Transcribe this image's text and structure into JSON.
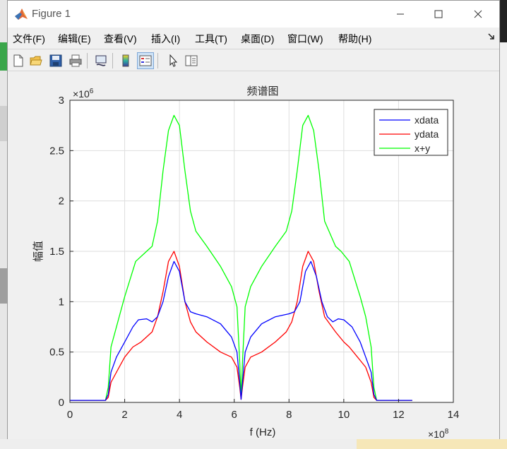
{
  "window": {
    "title": "Figure 1"
  },
  "menu": {
    "items": [
      {
        "label": "文件(F)",
        "name": "menu-file"
      },
      {
        "label": "编辑(E)",
        "name": "menu-edit"
      },
      {
        "label": "查看(V)",
        "name": "menu-view"
      },
      {
        "label": "插入(I)",
        "name": "menu-insert"
      },
      {
        "label": "工具(T)",
        "name": "menu-tools"
      },
      {
        "label": "桌面(D)",
        "name": "menu-desktop"
      },
      {
        "label": "窗口(W)",
        "name": "menu-window"
      },
      {
        "label": "帮助(H)",
        "name": "menu-help"
      }
    ]
  },
  "toolbar": {
    "items": [
      "new-figure-icon",
      "open-file-icon",
      "save-icon",
      "print-icon",
      "link-plot-icon",
      "colorbar-icon",
      "legend-icon",
      "pointer-icon",
      "property-inspector-icon"
    ]
  },
  "chart_data": {
    "type": "line",
    "title": "频谱图",
    "xlabel": "f (Hz)",
    "ylabel": "幅值",
    "x_exponent": "×10^8",
    "y_exponent": "×10^6",
    "xlim": [
      0,
      14
    ],
    "ylim": [
      0,
      3
    ],
    "xticks": [
      0,
      2,
      4,
      6,
      8,
      10,
      12,
      14
    ],
    "yticks": [
      0,
      0.5,
      1,
      1.5,
      2,
      2.5,
      3
    ],
    "xtick_labels": [
      "0",
      "2",
      "4",
      "6",
      "8",
      "10",
      "12",
      "14"
    ],
    "ytick_labels": [
      "0",
      "0.5",
      "1",
      "1.5",
      "2",
      "2.5",
      "3"
    ],
    "grid": true,
    "legend_position": "top-right",
    "series": [
      {
        "name": "xdata",
        "color": "#0000ff",
        "x": [
          0,
          1.3,
          1.4,
          1.5,
          1.7,
          2.0,
          2.3,
          2.5,
          2.8,
          3.0,
          3.2,
          3.4,
          3.6,
          3.8,
          4.0,
          4.2,
          4.4,
          4.6,
          5.0,
          5.5,
          5.9,
          6.1,
          6.2,
          6.25,
          6.3,
          6.4,
          6.6,
          7.0,
          7.5,
          8.0,
          8.2,
          8.4,
          8.6,
          8.8,
          9.0,
          9.2,
          9.4,
          9.6,
          9.8,
          10.0,
          10.3,
          10.6,
          10.8,
          11.0,
          11.1,
          11.2,
          12.5
        ],
        "y": [
          0.02,
          0.02,
          0.08,
          0.3,
          0.45,
          0.6,
          0.75,
          0.82,
          0.83,
          0.8,
          0.85,
          1.0,
          1.25,
          1.4,
          1.3,
          1.0,
          0.9,
          0.88,
          0.85,
          0.78,
          0.65,
          0.5,
          0.2,
          0.03,
          0.2,
          0.5,
          0.65,
          0.78,
          0.85,
          0.88,
          0.9,
          1.0,
          1.3,
          1.4,
          1.25,
          1.0,
          0.85,
          0.8,
          0.83,
          0.82,
          0.75,
          0.6,
          0.45,
          0.3,
          0.08,
          0.02,
          0.02
        ]
      },
      {
        "name": "ydata",
        "color": "#ff0000",
        "x": [
          0,
          1.3,
          1.4,
          1.5,
          1.8,
          2.0,
          2.3,
          2.6,
          3.0,
          3.2,
          3.4,
          3.6,
          3.8,
          4.0,
          4.2,
          4.4,
          4.6,
          5.0,
          5.5,
          5.9,
          6.1,
          6.2,
          6.25,
          6.3,
          6.4,
          6.6,
          7.0,
          7.5,
          7.9,
          8.1,
          8.3,
          8.5,
          8.7,
          8.9,
          9.1,
          9.3,
          9.7,
          10.0,
          10.2,
          10.5,
          10.8,
          11.0,
          11.1,
          11.2,
          12.5
        ],
        "y": [
          0.02,
          0.02,
          0.05,
          0.2,
          0.35,
          0.45,
          0.55,
          0.6,
          0.7,
          0.85,
          1.1,
          1.4,
          1.5,
          1.35,
          1.0,
          0.8,
          0.7,
          0.6,
          0.5,
          0.45,
          0.35,
          0.15,
          0.03,
          0.15,
          0.35,
          0.45,
          0.5,
          0.6,
          0.7,
          0.8,
          1.0,
          1.35,
          1.5,
          1.4,
          1.1,
          0.85,
          0.7,
          0.6,
          0.55,
          0.45,
          0.35,
          0.2,
          0.05,
          0.02,
          0.02
        ]
      },
      {
        "name": "x+y",
        "color": "#00ff00",
        "x": [
          0,
          1.3,
          1.4,
          1.5,
          1.8,
          2.0,
          2.4,
          2.8,
          3.0,
          3.2,
          3.4,
          3.6,
          3.8,
          4.0,
          4.2,
          4.4,
          4.6,
          5.0,
          5.5,
          5.9,
          6.1,
          6.2,
          6.25,
          6.3,
          6.4,
          6.6,
          7.0,
          7.5,
          7.9,
          8.1,
          8.3,
          8.5,
          8.7,
          8.9,
          9.1,
          9.3,
          9.7,
          9.9,
          10.2,
          10.6,
          10.8,
          11.0,
          11.1,
          11.2,
          12.5
        ],
        "y": [
          0.02,
          0.02,
          0.15,
          0.55,
          0.85,
          1.05,
          1.4,
          1.5,
          1.55,
          1.8,
          2.3,
          2.7,
          2.85,
          2.75,
          2.3,
          1.9,
          1.7,
          1.55,
          1.35,
          1.15,
          0.95,
          0.4,
          0.05,
          0.4,
          0.95,
          1.15,
          1.35,
          1.55,
          1.7,
          1.9,
          2.3,
          2.75,
          2.85,
          2.7,
          2.3,
          1.8,
          1.55,
          1.5,
          1.4,
          1.05,
          0.85,
          0.55,
          0.15,
          0.02,
          0.02
        ]
      }
    ]
  }
}
